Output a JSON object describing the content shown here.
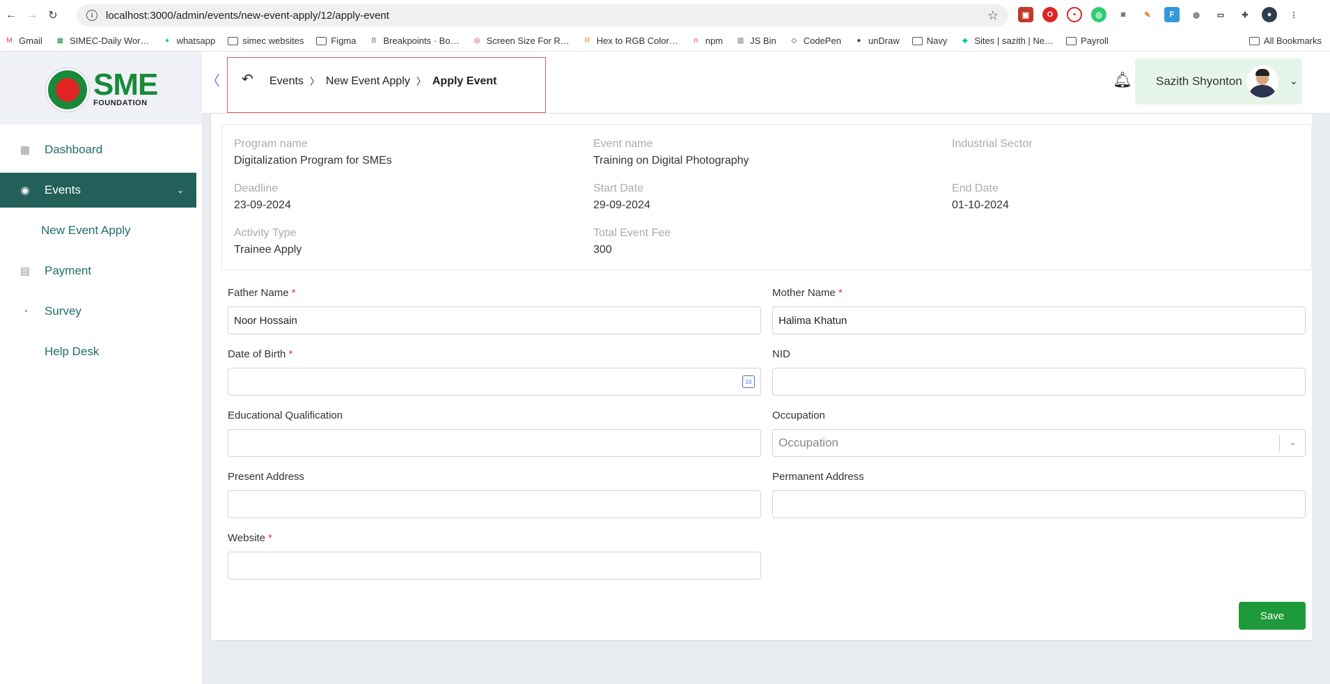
{
  "browser": {
    "url": "localhost:3000/admin/events/new-event-apply/12/apply-event",
    "bookmarks": [
      {
        "label": "Gmail",
        "icon": "gmail-icon",
        "color": "#d44638"
      },
      {
        "label": "SIMEC-Daily Wor…",
        "icon": "sheets-icon",
        "color": "#1e8e3e"
      },
      {
        "label": "whatsapp",
        "icon": "whatsapp-icon",
        "color": "#25d366"
      },
      {
        "label": "simec websites",
        "icon": "folder-icon",
        "color": "#555555"
      },
      {
        "label": "Figma",
        "icon": "folder-icon",
        "color": "#555555"
      },
      {
        "label": "Breakpoints · Bo…",
        "icon": "bootstrap-icon",
        "color": "#7952b3"
      },
      {
        "label": "Screen Size For R…",
        "icon": "globe-icon",
        "color": "#c0392b"
      },
      {
        "label": "Hex to RGB Color…",
        "icon": "hex-icon",
        "color": "#e67e22"
      },
      {
        "label": "npm",
        "icon": "npm-icon",
        "color": "#cb3837"
      },
      {
        "label": "JS Bin",
        "icon": "jsbin-icon",
        "color": "#555555"
      },
      {
        "label": "CodePen",
        "icon": "codepen-icon",
        "color": "#222222"
      },
      {
        "label": "unDraw",
        "icon": "undraw-icon",
        "color": "#3f3d56"
      },
      {
        "label": "Navy",
        "icon": "folder-icon",
        "color": "#555555"
      },
      {
        "label": "Sites | sazith | Ne…",
        "icon": "netlify-icon",
        "color": "#00c7b7"
      },
      {
        "label": "Payroll",
        "icon": "folder-icon",
        "color": "#555555"
      }
    ],
    "all_bookmarks": "All Bookmarks"
  },
  "sidebar": {
    "logo_text": "SME",
    "logo_sub": "FOUNDATION",
    "items": [
      {
        "label": "Dashboard",
        "icon": "grid-icon"
      },
      {
        "label": "Events",
        "icon": "events-icon"
      },
      {
        "label": "New Event Apply"
      },
      {
        "label": "Payment",
        "icon": "payment-icon"
      },
      {
        "label": "Survey",
        "icon": "pie-chart-icon"
      },
      {
        "label": "Help Desk"
      }
    ]
  },
  "header": {
    "breadcrumb": [
      "Events",
      "New Event Apply",
      "Apply Event"
    ],
    "user_name": "Sazith Shyonton"
  },
  "info": {
    "program_name_label": "Program name",
    "program_name": "Digitalization Program for SMEs",
    "event_name_label": "Event name",
    "event_name": "Training on Digital Photography",
    "industrial_sector_label": "Industrial Sector",
    "industrial_sector": "",
    "deadline_label": "Deadline",
    "deadline": "23-09-2024",
    "start_date_label": "Start Date",
    "start_date": "29-09-2024",
    "end_date_label": "End Date",
    "end_date": "01-10-2024",
    "activity_type_label": "Activity Type",
    "activity_type": "Trainee Apply",
    "total_fee_label": "Total Event Fee",
    "total_fee": "300"
  },
  "form": {
    "father_name_label": "Father Name",
    "father_name": "Noor Hossain",
    "mother_name_label": "Mother Name",
    "mother_name": "Halima Khatun",
    "dob_label": "Date of Birth",
    "dob": "",
    "nid_label": "NID",
    "nid": "",
    "education_label": "Educational Qualification",
    "education": "",
    "occupation_label": "Occupation",
    "occupation_placeholder": "Occupation",
    "present_address_label": "Present Address",
    "present_address": "",
    "permanent_address_label": "Permanent Address",
    "permanent_address": "",
    "website_label": "Website",
    "website": "",
    "required_mark": "*",
    "save_label": "Save"
  },
  "colors": {
    "sidebar_active": "#23605a",
    "save_button": "#1e9a3a",
    "highlight_box": "#e05a5a"
  }
}
